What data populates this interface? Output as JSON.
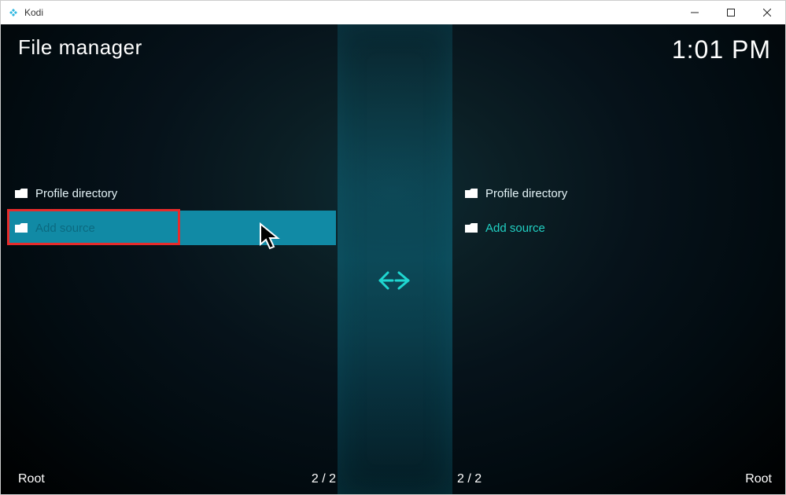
{
  "window": {
    "title": "Kodi"
  },
  "header": {
    "screen_title": "File manager",
    "clock": "1:01 PM"
  },
  "panes": {
    "left": {
      "items": [
        {
          "label": "Profile directory",
          "accent": false
        },
        {
          "label": "Add source",
          "accent": true
        }
      ],
      "footer_label": "Root",
      "footer_count": "2 / 2"
    },
    "right": {
      "items": [
        {
          "label": "Profile directory",
          "accent": false
        },
        {
          "label": "Add source",
          "accent": true
        }
      ],
      "footer_label": "Root",
      "footer_count": "2 / 2"
    }
  }
}
